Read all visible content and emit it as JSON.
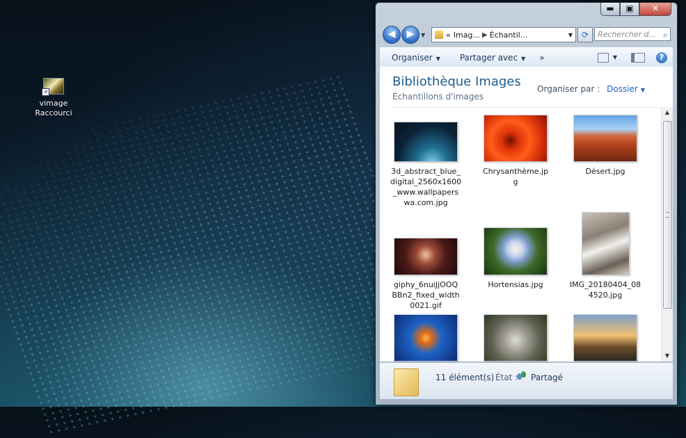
{
  "desktop": {
    "shortcut": {
      "name": "vimage",
      "type": "Raccourci"
    }
  },
  "window": {
    "caption": {
      "minimize": "▬",
      "maximize": "▣",
      "close": "✕"
    },
    "nav": {
      "back": "◀",
      "forward": "▶"
    },
    "address": {
      "parts": [
        "Imag...",
        "Échantil..."
      ],
      "prefix": "«"
    },
    "search_placeholder": "Rechercher d...",
    "toolbar": {
      "organize": "Organiser",
      "share": "Partager avec",
      "more": "»",
      "help": "?"
    },
    "library": {
      "title": "Bibliothèque Images",
      "subtitle": "Échantillons d'images",
      "arrange_label": "Organiser par :",
      "arrange_value": "Dossier"
    },
    "items": [
      {
        "name": "3d_abstract_blue_digital_2560x1600_www.wallpaperswa.com.jpg",
        "lines": [
          "3d_abstract_blue_",
          "digital_2560x1600",
          "_www.wallpapers",
          "wa.com.jpg"
        ],
        "thumb": "abstract"
      },
      {
        "name": "Chrysanthème.jpg",
        "lines": [
          "Chrysanthème.jp",
          "g"
        ],
        "thumb": "chrys"
      },
      {
        "name": "Désert.jpg",
        "lines": [
          "Désert.jpg"
        ],
        "thumb": "desert"
      },
      {
        "name": "giphy_6nuiJjOOQBBn2_fixed_width0021.gif",
        "lines": [
          "giphy_6nuiJjOOQ",
          "BBn2_fixed_width",
          "0021.gif"
        ],
        "thumb": "giphy"
      },
      {
        "name": "Hortensias.jpg",
        "lines": [
          "Hortensias.jpg"
        ],
        "thumb": "hort"
      },
      {
        "name": "IMG_20180404_084520.jpg",
        "lines": [
          "IMG_20180404_08",
          "4520.jpg"
        ],
        "thumb": "img"
      },
      {
        "name": "",
        "lines": [],
        "thumb": "jelly"
      },
      {
        "name": "",
        "lines": [],
        "thumb": "koala"
      },
      {
        "name": "",
        "lines": [],
        "thumb": "light"
      }
    ],
    "status": {
      "count": "11 élément(s)",
      "state_label": "État :",
      "state_value": "Partagé"
    }
  }
}
